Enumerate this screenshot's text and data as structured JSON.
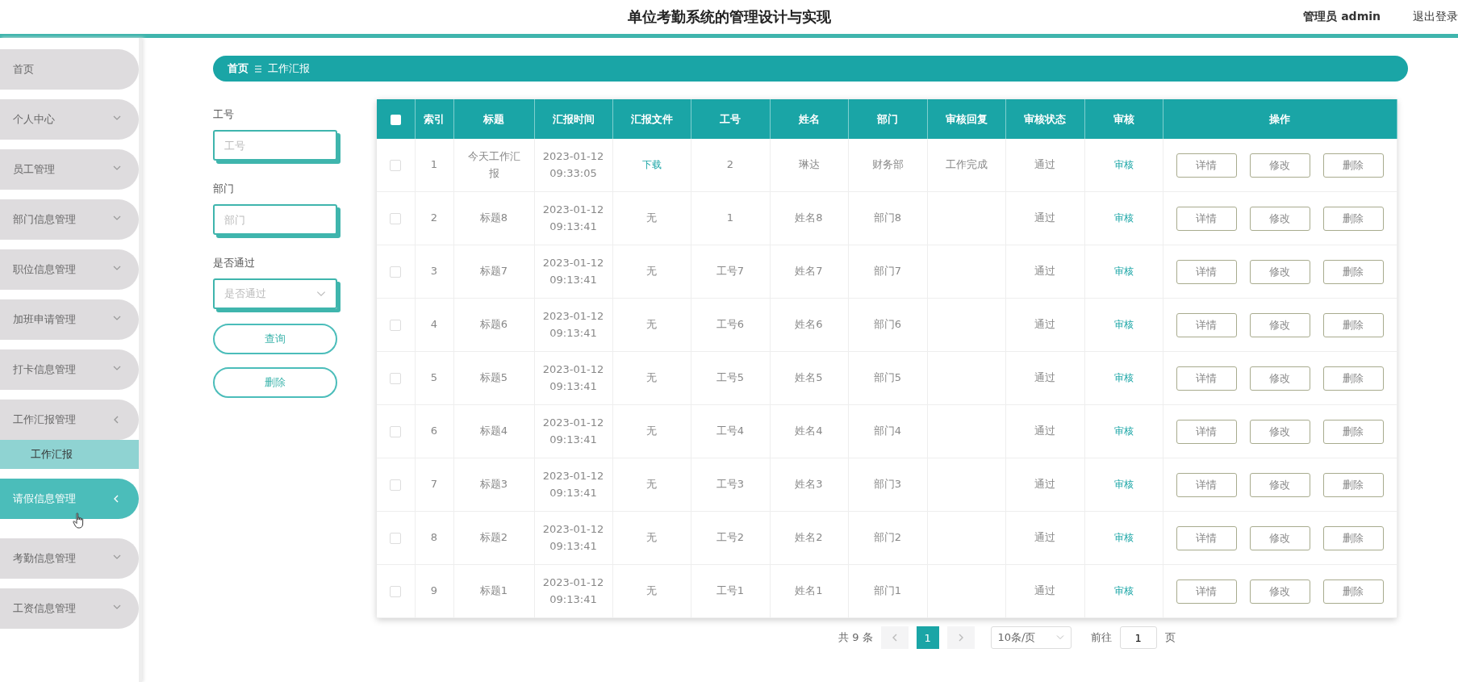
{
  "header": {
    "title": "单位考勤系统的管理设计与实现",
    "user": "管理员 admin",
    "logout": "退出登录"
  },
  "sidebar": {
    "items": [
      {
        "label": "首页",
        "kind": "link",
        "hovered": false
      },
      {
        "label": "个人中心",
        "kind": "menu",
        "expanded": false,
        "hovered": false
      },
      {
        "label": "员工管理",
        "kind": "menu",
        "expanded": false,
        "hovered": false
      },
      {
        "label": "部门信息管理",
        "kind": "menu",
        "expanded": false,
        "hovered": false
      },
      {
        "label": "职位信息管理",
        "kind": "menu",
        "expanded": false,
        "hovered": false
      },
      {
        "label": "加班申请管理",
        "kind": "menu",
        "expanded": false,
        "hovered": false
      },
      {
        "label": "打卡信息管理",
        "kind": "menu",
        "expanded": false,
        "hovered": false
      },
      {
        "label": "工作汇报管理",
        "kind": "menu",
        "expanded": true,
        "hovered": false,
        "children": [
          {
            "label": "工作汇报",
            "selected": true
          }
        ]
      },
      {
        "label": "请假信息管理",
        "kind": "menu",
        "expanded": true,
        "hovered": true
      },
      {
        "label": "考勤信息管理",
        "kind": "menu",
        "expanded": false,
        "hovered": false
      },
      {
        "label": "工资信息管理",
        "kind": "menu",
        "expanded": false,
        "hovered": false
      }
    ]
  },
  "breadcrumb": [
    "首页",
    "工作汇报"
  ],
  "filters": [
    {
      "label": "工号",
      "kind": "input",
      "placeholder": "工号"
    },
    {
      "label": "部门",
      "kind": "input",
      "placeholder": "部门"
    },
    {
      "label": "是否通过",
      "kind": "select",
      "placeholder": "是否通过"
    }
  ],
  "filter_buttons": [
    "查询",
    "删除"
  ],
  "table": {
    "all_checked": false,
    "columns": [
      "索引",
      "标题",
      "汇报时间",
      "汇报文件",
      "工号",
      "姓名",
      "部门",
      "审核回复",
      "审核状态",
      "审核",
      "操作"
    ],
    "rows": [
      {
        "checked": false,
        "index": "1",
        "title": "今天工作汇报",
        "time": [
          "2023-01-12",
          "09:33:05"
        ],
        "file": {
          "kind": "link",
          "text": "下载"
        },
        "emp_no": "2",
        "name": "琳达",
        "dept": "财务部",
        "reply": "工作完成",
        "status": "通过",
        "audit": "审核",
        "actions": [
          "详情",
          "修改",
          "删除"
        ]
      },
      {
        "checked": false,
        "index": "2",
        "title": "标题8",
        "time": [
          "2023-01-12",
          "09:13:41"
        ],
        "file": {
          "kind": "text",
          "text": "无"
        },
        "emp_no": "1",
        "name": "姓名8",
        "dept": "部门8",
        "status": "通过",
        "audit": "审核",
        "actions": [
          "详情",
          "修改",
          "删除"
        ]
      },
      {
        "checked": false,
        "index": "3",
        "title": "标题7",
        "time": [
          "2023-01-12",
          "09:13:41"
        ],
        "file": {
          "kind": "text",
          "text": "无"
        },
        "emp_no": "工号7",
        "name": "姓名7",
        "dept": "部门7",
        "status": "通过",
        "audit": "审核",
        "actions": [
          "详情",
          "修改",
          "删除"
        ]
      },
      {
        "checked": false,
        "index": "4",
        "title": "标题6",
        "time": [
          "2023-01-12",
          "09:13:41"
        ],
        "file": {
          "kind": "text",
          "text": "无"
        },
        "emp_no": "工号6",
        "name": "姓名6",
        "dept": "部门6",
        "status": "通过",
        "audit": "审核",
        "actions": [
          "详情",
          "修改",
          "删除"
        ]
      },
      {
        "checked": false,
        "index": "5",
        "title": "标题5",
        "time": [
          "2023-01-12",
          "09:13:41"
        ],
        "file": {
          "kind": "text",
          "text": "无"
        },
        "emp_no": "工号5",
        "name": "姓名5",
        "dept": "部门5",
        "status": "通过",
        "audit": "审核",
        "actions": [
          "详情",
          "修改",
          "删除"
        ]
      },
      {
        "checked": false,
        "index": "6",
        "title": "标题4",
        "time": [
          "2023-01-12",
          "09:13:41"
        ],
        "file": {
          "kind": "text",
          "text": "无"
        },
        "emp_no": "工号4",
        "name": "姓名4",
        "dept": "部门4",
        "status": "通过",
        "audit": "审核",
        "actions": [
          "详情",
          "修改",
          "删除"
        ]
      },
      {
        "checked": false,
        "index": "7",
        "title": "标题3",
        "time": [
          "2023-01-12",
          "09:13:41"
        ],
        "file": {
          "kind": "text",
          "text": "无"
        },
        "emp_no": "工号3",
        "name": "姓名3",
        "dept": "部门3",
        "status": "通过",
        "audit": "审核",
        "actions": [
          "详情",
          "修改",
          "删除"
        ]
      },
      {
        "checked": false,
        "index": "8",
        "title": "标题2",
        "time": [
          "2023-01-12",
          "09:13:41"
        ],
        "file": {
          "kind": "text",
          "text": "无"
        },
        "emp_no": "工号2",
        "name": "姓名2",
        "dept": "部门2",
        "status": "通过",
        "audit": "审核",
        "actions": [
          "详情",
          "修改",
          "删除"
        ]
      },
      {
        "checked": false,
        "index": "9",
        "title": "标题1",
        "time": [
          "2023-01-12",
          "09:13:41"
        ],
        "file": {
          "kind": "text",
          "text": "无"
        },
        "emp_no": "工号1",
        "name": "姓名1",
        "dept": "部门1",
        "status": "通过",
        "audit": "审核",
        "actions": [
          "详情",
          "修改",
          "删除"
        ]
      }
    ]
  },
  "pagination": {
    "total": "共 9 条",
    "pages": [
      {
        "label": "1",
        "selected": true
      }
    ],
    "page_size": "10条/页",
    "goto_label": "前往",
    "goto_value": "1",
    "goto_suffix": "页"
  }
}
